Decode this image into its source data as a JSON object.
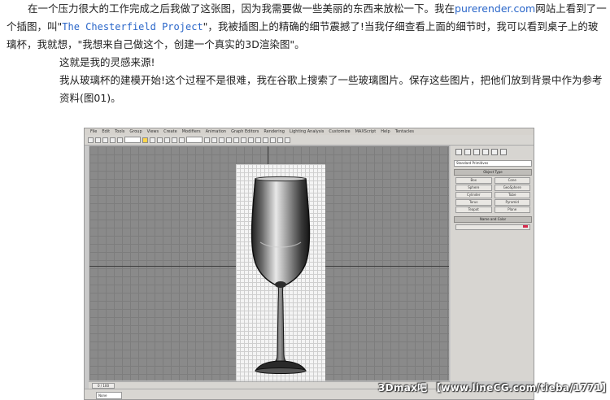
{
  "article": {
    "para1": {
      "pre": "在一个压力很大的工作完成之后我做了这张图，因为我需要做一些美丽的东西来放松一下。我在",
      "link": "purerender.com",
      "mid1": "网站上看到了一个插图，叫\"",
      "project": "The Chesterfield Project",
      "post": "\"，我被插图上的精确的细节震撼了!当我仔细查看上面的细节时，我可以看到桌子上的玻璃杯，我就想，\"我想来自己做这个，创建一个真实的3D渲染图\"。"
    },
    "para2": "这就是我的灵感来源!",
    "para3": "我从玻璃杯的建模开始!这个过程不是很难，我在谷歌上搜索了一些玻璃图片。保存这些图片，把他们放到背景中作为参考资料(图01)。"
  },
  "screenshot": {
    "menu": [
      "File",
      "Edit",
      "Tools",
      "Group",
      "Views",
      "Create",
      "Modifiers",
      "Animation",
      "Graph Editors",
      "Rendering",
      "Lighting Analysis",
      "Customize",
      "MAXScript",
      "Help",
      "Tentacles"
    ],
    "panel": {
      "dropdown": "Standard Primitives",
      "object_type": "Object Type",
      "buttons": [
        "Box",
        "Cone",
        "Sphere",
        "GeoSphere",
        "Cylinder",
        "Tube",
        "Torus",
        "Pyramid",
        "Teapot",
        "Plane"
      ],
      "name_color": "Name and Color"
    },
    "timeline": "0 / 100",
    "status": "None Selected"
  },
  "watermark": "3Dmax吧 【www.lineCG.com/tieba/1771】"
}
